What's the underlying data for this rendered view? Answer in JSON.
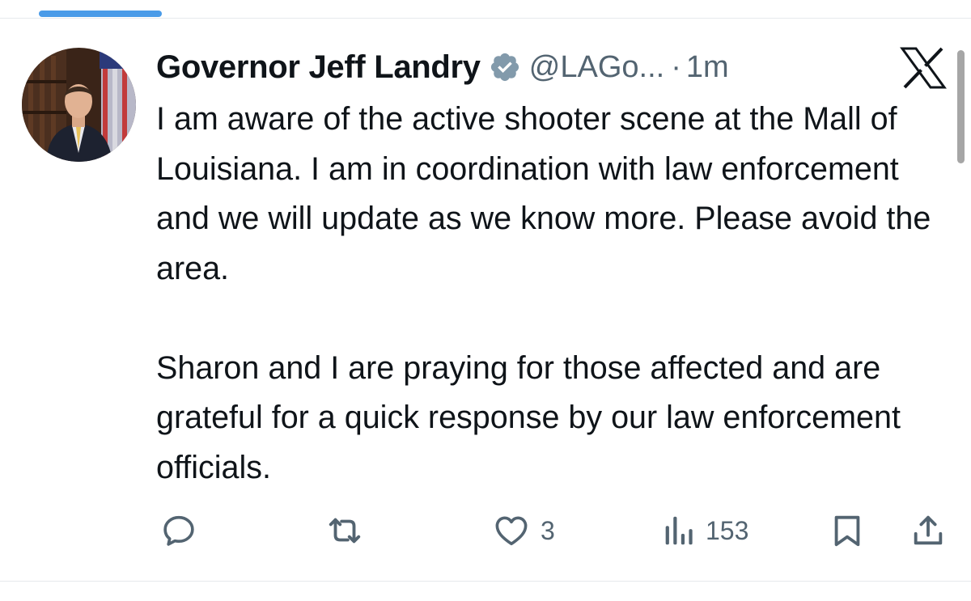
{
  "author": {
    "display_name": "Governor Jeff Landry",
    "handle": "@LAGo...",
    "separator": "·",
    "timestamp": "1m",
    "verified_badge": "verified-badge-icon",
    "avatar": "profile-photo"
  },
  "tweet": {
    "paragraphs": [
      "I am aware of the active shooter scene at the Mall of Louisiana. I am in coordination with law enforcement and we will update as we know more. Please avoid the area.",
      "Sharon and I are praying for those affected and are grateful for a quick response by our law enforcement officials."
    ]
  },
  "actions": {
    "reply_icon": "comment-icon",
    "repost_icon": "repost-icon",
    "like_icon": "heart-icon",
    "like_count": "3",
    "views_icon": "views-icon",
    "views_count": "153",
    "bookmark_icon": "bookmark-icon",
    "share_icon": "share-icon"
  },
  "brand": {
    "logo": "x-logo-icon"
  },
  "colors": {
    "text": "#0f1419",
    "muted": "#536471",
    "tab_indicator": "#4a9be8",
    "divider": "#e6e9ec",
    "scrollbar": "#a6a6a6"
  }
}
